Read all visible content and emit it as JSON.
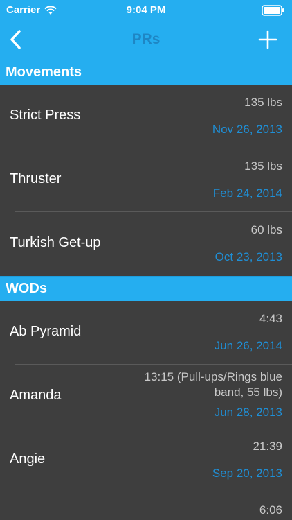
{
  "status_bar": {
    "carrier": "Carrier",
    "time": "9:04 PM"
  },
  "nav": {
    "title": "PRs",
    "back_icon": "chevron-left-icon",
    "add_icon": "plus-icon"
  },
  "sections": [
    {
      "header": "Movements",
      "rows": [
        {
          "name": "Strict Press",
          "value": "135 lbs",
          "date": "Nov 26, 2013"
        },
        {
          "name": "Thruster",
          "value": "135 lbs",
          "date": "Feb 24, 2014"
        },
        {
          "name": "Turkish Get-up",
          "value": "60 lbs",
          "date": "Oct 23, 2013"
        }
      ]
    },
    {
      "header": "WODs",
      "rows": [
        {
          "name": "Ab Pyramid",
          "value": "4:43",
          "date": "Jun 26, 2014"
        },
        {
          "name": "Amanda",
          "value": "13:15 (Pull-ups/Rings blue band, 55 lbs)",
          "date": "Jun 28, 2013"
        },
        {
          "name": "Angie",
          "value": "21:39",
          "date": "Sep 20, 2013"
        },
        {
          "name": "",
          "value": "6:06",
          "date": ""
        }
      ]
    }
  ],
  "colors": {
    "accent": "#25aef0",
    "title": "#1e86c4",
    "background": "#3e3e3e",
    "date": "#1f8fd6"
  }
}
